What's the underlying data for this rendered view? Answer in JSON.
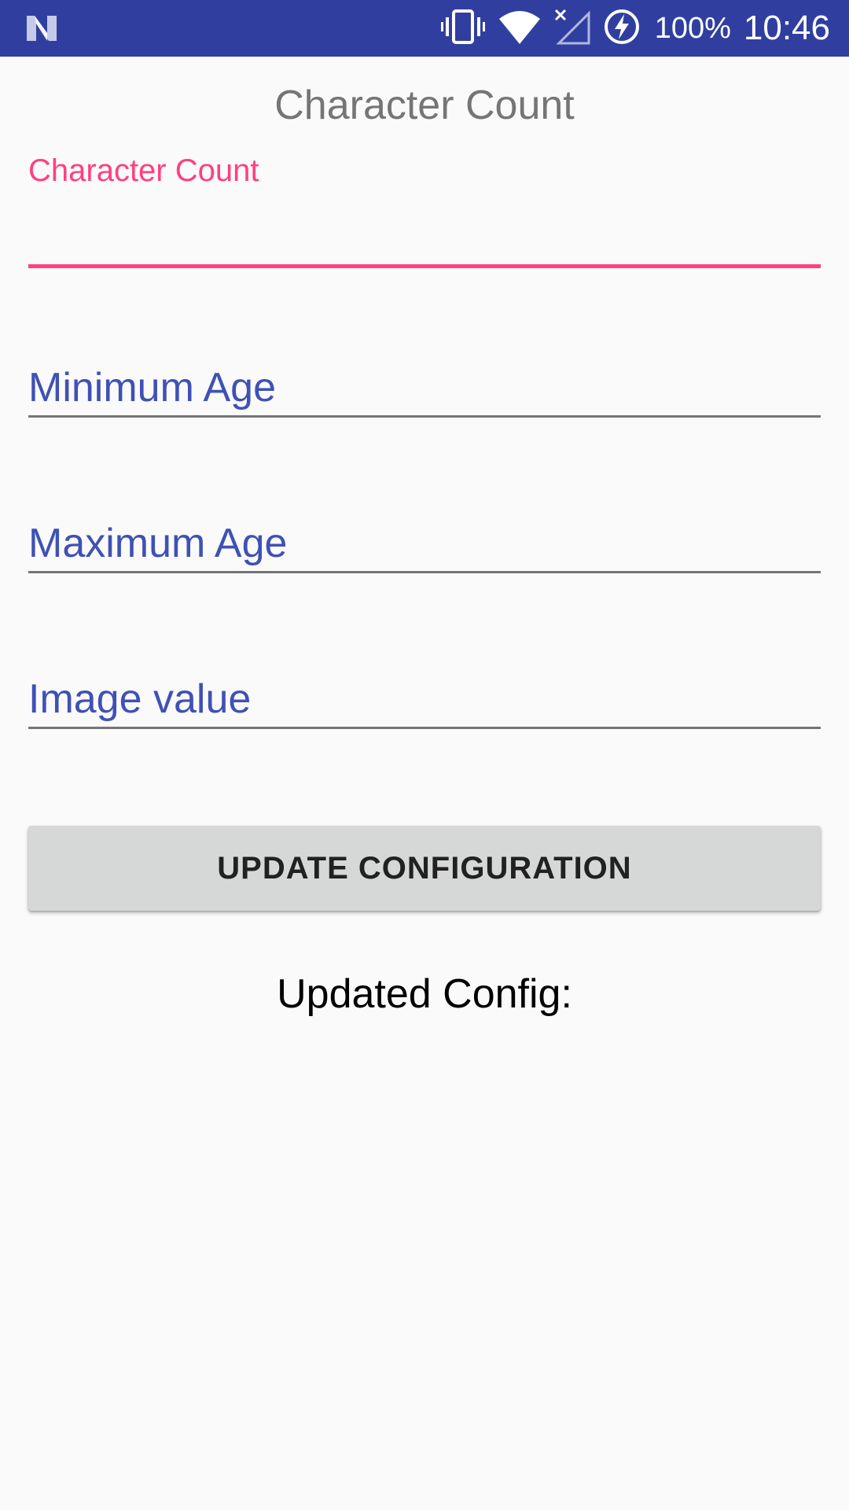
{
  "status_bar": {
    "battery_percent": "100%",
    "time": "10:46",
    "icons": [
      "n-logo-icon",
      "vibrate-icon",
      "wifi-icon",
      "no-signal-icon",
      "battery-charging-icon"
    ],
    "background_color": "#303f9f"
  },
  "app": {
    "title": "Character Count"
  },
  "form": {
    "character_count": {
      "label": "Character Count",
      "value": ""
    },
    "minimum_age": {
      "placeholder": "Minimum Age",
      "value": ""
    },
    "maximum_age": {
      "placeholder": "Maximum Age",
      "value": ""
    },
    "image_value": {
      "placeholder": "Image value",
      "value": ""
    }
  },
  "button": {
    "update_label": "UPDATE CONFIGURATION"
  },
  "result": {
    "label": "Updated Config:"
  },
  "colors": {
    "accent": "#ff4081",
    "primary": "#3f51b5",
    "primary_dark": "#303f9f"
  }
}
